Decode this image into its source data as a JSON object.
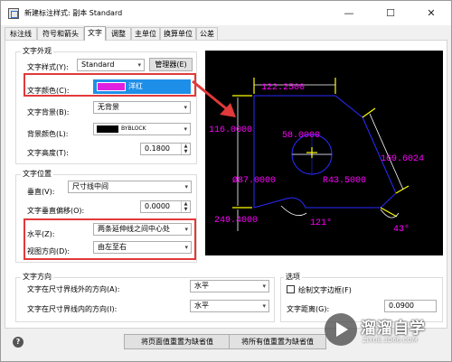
{
  "window": {
    "title": "新建标注样式: 副本 Standard",
    "minimize": "—",
    "maximize": "☐",
    "close": "✕"
  },
  "tabs": [
    {
      "label": "标注线"
    },
    {
      "label": "符号和箭头"
    },
    {
      "label": "文字",
      "active": true
    },
    {
      "label": "调整"
    },
    {
      "label": "主单位"
    },
    {
      "label": "换算单位"
    },
    {
      "label": "公差"
    }
  ],
  "text_appearance": {
    "group_label": "文字外观",
    "style_label": "文字样式(Y):",
    "style_value": "Standard",
    "manager_button": "管理器(E)",
    "color_label": "文字颜色(C):",
    "color_value": "洋红",
    "color_swatch": "#e020e0",
    "fill_label": "文字背景(B):",
    "fill_value": "无背景",
    "bg_color_label": "背景颜色(L):",
    "bg_color_value": "BYBLOCK",
    "height_label": "文字高度(T):",
    "height_value": "0.1800"
  },
  "text_placement": {
    "group_label": "文字位置",
    "vertical_label": "垂直(V):",
    "vertical_value": "尺寸线中间",
    "offset_label": "文字垂直偏移(O):",
    "offset_value": "0.0000",
    "horizontal_label": "水平(Z):",
    "horizontal_value": "两条延伸线之间中心处",
    "view_dir_label": "视图方向(D):",
    "view_dir_value": "由左至右"
  },
  "text_direction": {
    "group_label": "文字方向",
    "outside_label": "文字在尺寸界线外的方向(A):",
    "outside_value": "水平",
    "inside_label": "文字在尺寸界线内的方向(I):",
    "inside_value": "水平"
  },
  "options": {
    "group_label": "选项",
    "draw_frame_label": "绘制文字边框(F)",
    "draw_frame_checked": false,
    "distance_label": "文字距离(G):",
    "distance_value": "0.0900"
  },
  "preview": {
    "dims": {
      "top": "122.2500",
      "left": "116.0000",
      "center": "58.0000",
      "right": "169.6024",
      "diameter": "Ø87.0000",
      "radius": "R43.5000",
      "bottom": "249.4000",
      "angle1": "121°",
      "angle2": "43°"
    },
    "text_color": "#ff00ff",
    "line_color": "#2a2aff",
    "ext_color": "#ffff00"
  },
  "footer": {
    "reset_page": "将页面值重置为缺省值",
    "reset_all": "将所有值重置为缺省值",
    "help": "?"
  },
  "watermark": {
    "text": "溜溜自学",
    "sub": "ZIXUE.3D66.COM"
  }
}
